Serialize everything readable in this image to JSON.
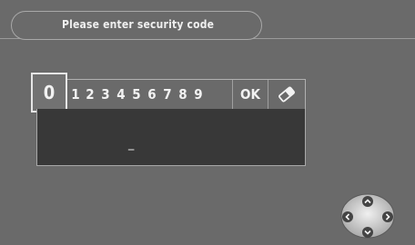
{
  "dialog": {
    "title": "Please enter security code"
  },
  "keypad": {
    "selected_key": "0",
    "digits": [
      "1",
      "2",
      "3",
      "4",
      "5",
      "6",
      "7",
      "8",
      "9"
    ],
    "ok_label": "OK",
    "erase_icon": "eraser-icon"
  },
  "entry": {
    "value": "_"
  },
  "navigation": {
    "icons": [
      "nav-up-icon",
      "nav-down-icon",
      "nav-left-icon",
      "nav-right-icon"
    ]
  }
}
